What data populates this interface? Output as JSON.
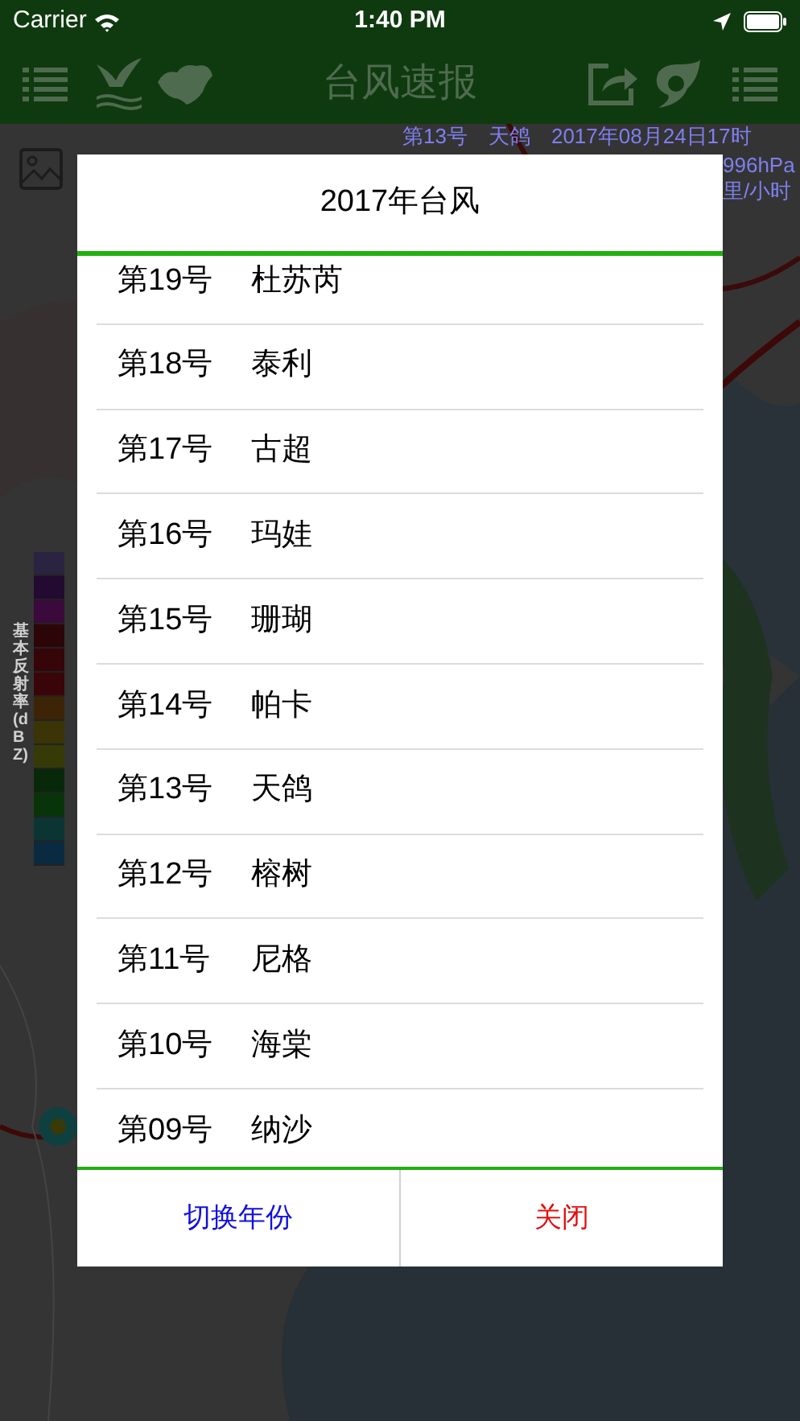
{
  "status_bar": {
    "carrier": "Carrier",
    "time": "1:40 PM"
  },
  "nav_bar": {
    "title": "台风速报"
  },
  "typhoon_info": {
    "line_1": "第13号　天鸽　2017年08月24日17时",
    "line_2": "996hPa",
    "line_3": "里/小时"
  },
  "legend": {
    "label": "基本反射率(dBZ)",
    "swatches": [
      {
        "color": "#2a2440"
      },
      {
        "color": "#220a30"
      },
      {
        "color": "#3a0a3a"
      },
      {
        "color": "#2c0508"
      },
      {
        "color": "#35050a"
      },
      {
        "color": "#3a0508"
      },
      {
        "color": "#3d2406"
      },
      {
        "color": "#3a3406"
      },
      {
        "color": "#363a06"
      },
      {
        "color": "#07290a"
      },
      {
        "color": "#073509"
      },
      {
        "color": "#0a3533"
      },
      {
        "color": "#0a2a40"
      }
    ]
  },
  "dialog": {
    "title": "2017年台风",
    "typhoons": [
      {
        "number": "第19号",
        "name": "杜苏芮"
      },
      {
        "number": "第18号",
        "name": "泰利"
      },
      {
        "number": "第17号",
        "name": "古超"
      },
      {
        "number": "第16号",
        "name": "玛娃"
      },
      {
        "number": "第15号",
        "name": "珊瑚"
      },
      {
        "number": "第14号",
        "name": "帕卡"
      },
      {
        "number": "第13号",
        "name": "天鸽"
      },
      {
        "number": "第12号",
        "name": "榕树"
      },
      {
        "number": "第11号",
        "name": "尼格"
      },
      {
        "number": "第10号",
        "name": "海棠"
      },
      {
        "number": "第09号",
        "name": "纳沙"
      }
    ],
    "buttons": [
      {
        "label": "切换年份",
        "kind": "switch"
      },
      {
        "label": "关闭",
        "kind": "close"
      }
    ]
  }
}
